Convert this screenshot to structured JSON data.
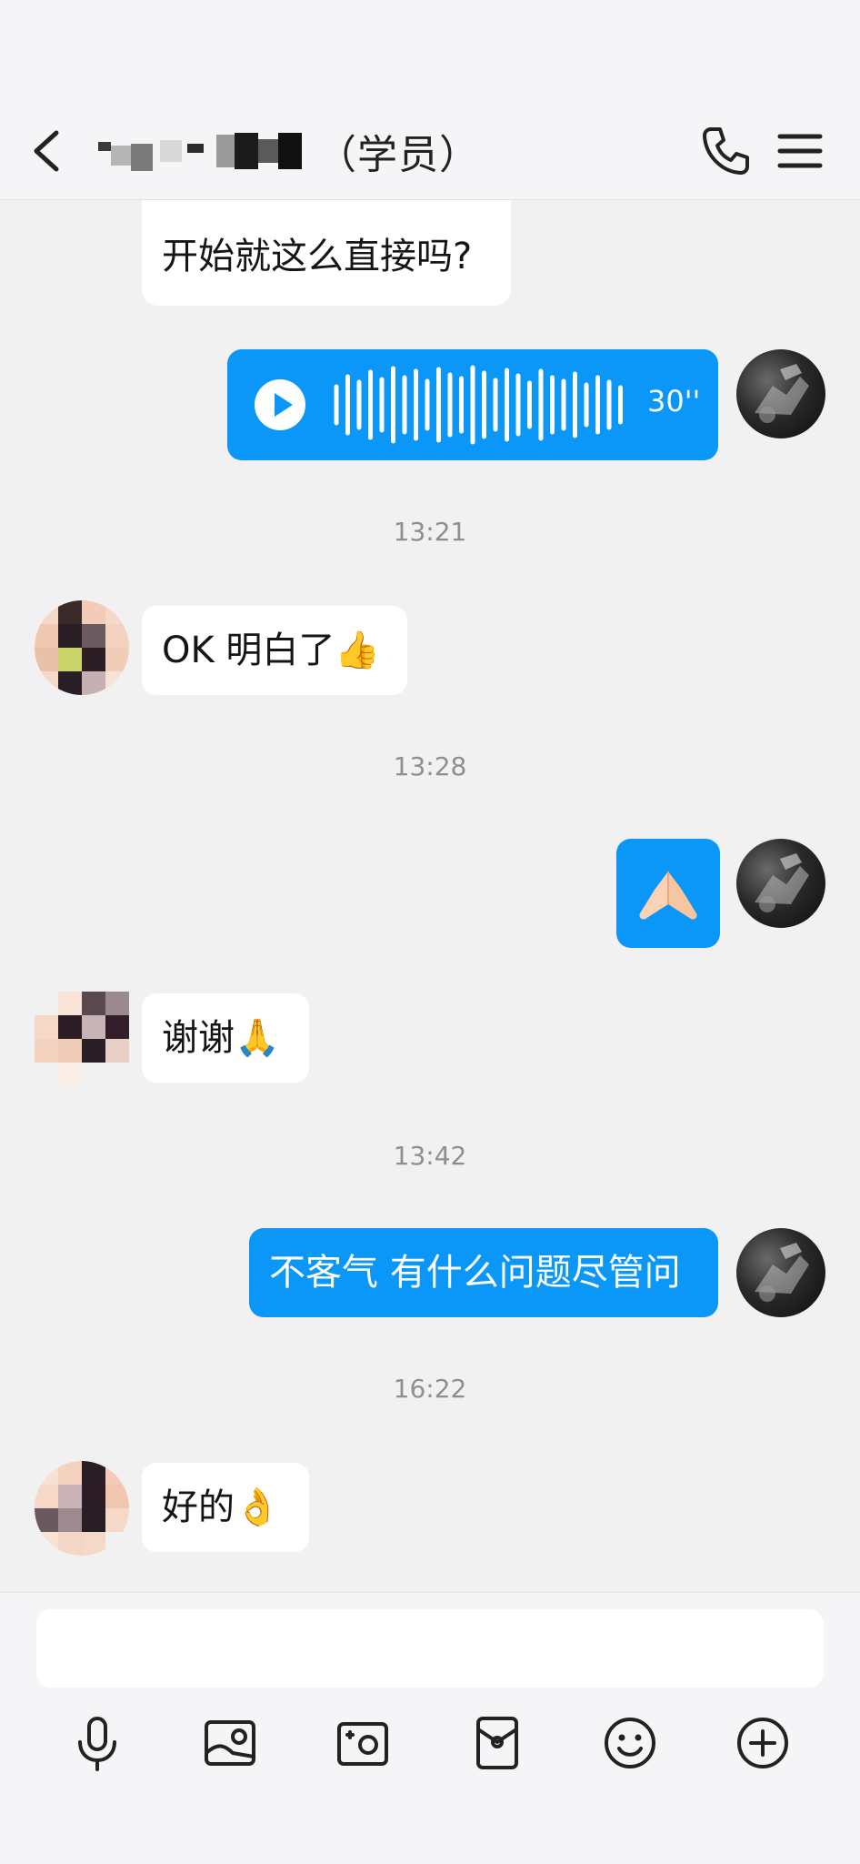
{
  "header": {
    "contact_suffix": "（学员）",
    "back_label": "Back",
    "call_label": "Call",
    "menu_label": "Menu"
  },
  "messages": [
    {
      "id": "m1",
      "side": "incoming",
      "type": "text",
      "text": "开始就这么直接吗?",
      "has_quote": true
    },
    {
      "id": "m2",
      "side": "outgoing",
      "type": "voice",
      "duration": "30''"
    },
    {
      "id": "t1",
      "type": "timestamp",
      "text": "13:21"
    },
    {
      "id": "m3",
      "side": "incoming",
      "type": "text",
      "text": "OK 明白了👍"
    },
    {
      "id": "t2",
      "type": "timestamp",
      "text": "13:28"
    },
    {
      "id": "m4",
      "side": "outgoing",
      "type": "emoji",
      "emoji": "🙏"
    },
    {
      "id": "m5",
      "side": "incoming",
      "type": "text",
      "text": "谢谢🙏"
    },
    {
      "id": "t3",
      "type": "timestamp",
      "text": "13:42"
    },
    {
      "id": "m6",
      "side": "outgoing",
      "type": "text",
      "text": "不客气 有什么问题尽管问"
    },
    {
      "id": "t4",
      "type": "timestamp",
      "text": "16:22"
    },
    {
      "id": "m7",
      "side": "incoming",
      "type": "text",
      "text": "好的👌"
    }
  ],
  "composer": {
    "placeholder": "",
    "toolbar": [
      {
        "icon": "microphone-icon"
      },
      {
        "icon": "photo-icon"
      },
      {
        "icon": "camera-icon"
      },
      {
        "icon": "red-packet-icon"
      },
      {
        "icon": "emoji-icon"
      },
      {
        "icon": "plus-icon"
      }
    ]
  },
  "colors": {
    "accent": "#0b97f7",
    "incoming_bubble": "#ffffff",
    "chat_background": "#f1f1f1",
    "timestamp": "#8e8e93"
  }
}
